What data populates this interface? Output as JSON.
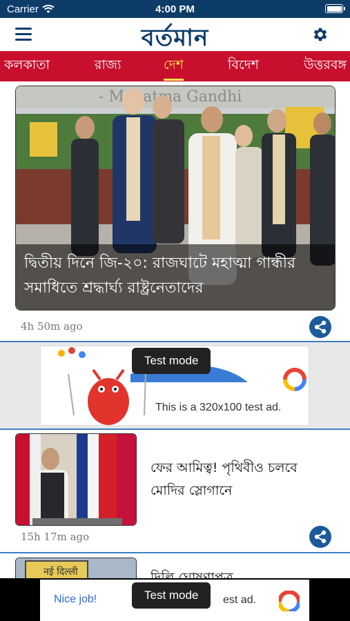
{
  "status_bar": {
    "carrier": "Carrier",
    "time": "4:00 PM"
  },
  "header": {
    "logo": "বর্তমান",
    "menu_icon": "hamburger-icon",
    "settings_icon": "gear-icon"
  },
  "categories": [
    {
      "label": "কলকাতা",
      "active": false
    },
    {
      "label": "রাজ্য",
      "active": false
    },
    {
      "label": "দেশ",
      "active": true
    },
    {
      "label": "বিদেশ",
      "active": false
    },
    {
      "label": "উত্তরবঙ্গ",
      "active": false
    }
  ],
  "hero": {
    "headline": "দ্বিতীয় দিনে জি-২০: রাজঘাটে মহাত্মা গান্ধীর সমাধিতে শ্রদ্ধার্ঘ্য রাষ্ট্রনেতাদের",
    "banner_text": "- Mahatma Gandhi",
    "time_ago": "4h 50m ago"
  },
  "ad_banner": {
    "test_mode": "Test mode",
    "text": "This is a 320x100 test ad."
  },
  "articles": [
    {
      "title": "ফের আমিত্ব! পৃথিবীও চলবে মোদির স্লোগানে",
      "time_ago": "15h 17m ago"
    },
    {
      "title": "দিল্লি ঘোষণাপত্র",
      "sign_text": "नई दिल्ली"
    }
  ],
  "bottom_ad": {
    "nice_job": "Nice job!",
    "test_mode": "Test mode",
    "text_partial": "est ad."
  },
  "colors": {
    "navy": "#0e3c69",
    "red": "#c8102e",
    "active_tab": "#ffe14d",
    "share_blue": "#1c5a9a"
  }
}
